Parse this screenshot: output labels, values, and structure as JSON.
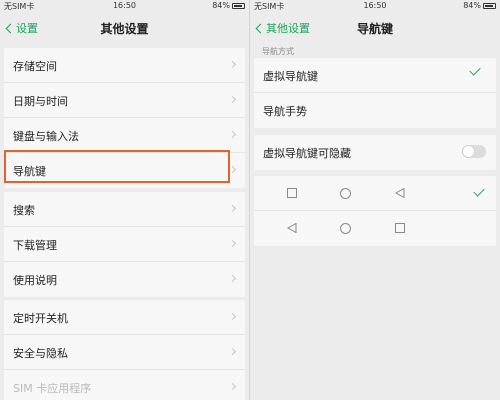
{
  "left": {
    "status": {
      "carrier": "无SIM卡",
      "time": "16:50",
      "battery": "84%"
    },
    "nav": {
      "back_label": "设置",
      "title": "其他设置"
    },
    "groups": [
      [
        "存储空间",
        "日期与时间",
        "键盘与输入法",
        "导航键"
      ],
      [
        "搜索",
        "下载管理",
        "使用说明"
      ],
      [
        "定时开关机",
        "安全与隐私",
        "SIM 卡应用程序"
      ]
    ],
    "highlighted_item": "导航键"
  },
  "right": {
    "status": {
      "carrier": "无SIM卡",
      "time": "16:50",
      "battery": "84%"
    },
    "nav": {
      "back_label": "其他设置",
      "title": "导航键"
    },
    "section_label": "导航方式",
    "options": [
      {
        "label": "虚拟导航键",
        "selected": true
      },
      {
        "label": "导航手势",
        "selected": false
      }
    ],
    "hide_toggle": {
      "label": "虚拟导航键可隐藏",
      "on": false
    },
    "layouts": [
      {
        "keys": [
          "square-icon",
          "circle-icon",
          "triangle-left-icon"
        ],
        "selected": true
      },
      {
        "keys": [
          "triangle-left-icon",
          "circle-icon",
          "square-icon"
        ],
        "selected": false
      }
    ],
    "accent_color": "#1fa25a"
  },
  "highlight_color": "#e0652b"
}
